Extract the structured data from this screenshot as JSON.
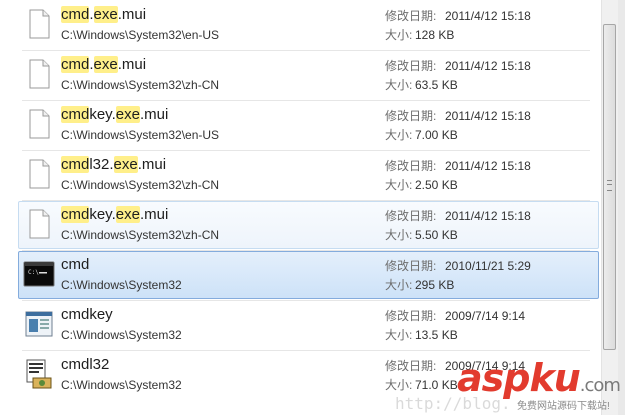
{
  "meta_labels": {
    "modified": "修改日期:",
    "size": "大小:"
  },
  "items": [
    {
      "name_parts": [
        {
          "t": "cmd",
          "hl": true
        },
        {
          "t": ".",
          "hl": false
        },
        {
          "t": "exe",
          "hl": true
        },
        {
          "t": ".mui",
          "hl": false
        }
      ],
      "path": "C:\\Windows\\System32\\en-US",
      "modified": "2011/4/12 15:18",
      "size": "128 KB",
      "icon": "blank-file-icon",
      "state": "normal"
    },
    {
      "name_parts": [
        {
          "t": "cmd",
          "hl": true
        },
        {
          "t": ".",
          "hl": false
        },
        {
          "t": "exe",
          "hl": true
        },
        {
          "t": ".mui",
          "hl": false
        }
      ],
      "path": "C:\\Windows\\System32\\zh-CN",
      "modified": "2011/4/12 15:18",
      "size": "63.5 KB",
      "icon": "blank-file-icon",
      "state": "normal"
    },
    {
      "name_parts": [
        {
          "t": "cmd",
          "hl": true
        },
        {
          "t": "key.",
          "hl": false
        },
        {
          "t": "exe",
          "hl": true
        },
        {
          "t": ".mui",
          "hl": false
        }
      ],
      "path": "C:\\Windows\\System32\\en-US",
      "modified": "2011/4/12 15:18",
      "size": "7.00 KB",
      "icon": "blank-file-icon",
      "state": "normal"
    },
    {
      "name_parts": [
        {
          "t": "cmd",
          "hl": true
        },
        {
          "t": "l32.",
          "hl": false
        },
        {
          "t": "exe",
          "hl": true
        },
        {
          "t": ".mui",
          "hl": false
        }
      ],
      "path": "C:\\Windows\\System32\\zh-CN",
      "modified": "2011/4/12 15:18",
      "size": "2.50 KB",
      "icon": "blank-file-icon",
      "state": "normal"
    },
    {
      "name_parts": [
        {
          "t": "cmd",
          "hl": true
        },
        {
          "t": "key.",
          "hl": false
        },
        {
          "t": "exe",
          "hl": true
        },
        {
          "t": ".mui",
          "hl": false
        }
      ],
      "path": "C:\\Windows\\System32\\zh-CN",
      "modified": "2011/4/12 15:18",
      "size": "5.50 KB",
      "icon": "blank-file-icon",
      "state": "hover"
    },
    {
      "name_parts": [
        {
          "t": "cmd",
          "hl": false
        }
      ],
      "path": "C:\\Windows\\System32",
      "modified": "2010/11/21 5:29",
      "size": "295 KB",
      "icon": "console-icon",
      "state": "selected"
    },
    {
      "name_parts": [
        {
          "t": "cmdkey",
          "hl": false
        }
      ],
      "path": "C:\\Windows\\System32",
      "modified": "2009/7/14 9:14",
      "size": "13.5 KB",
      "icon": "app-window-icon",
      "state": "normal"
    },
    {
      "name_parts": [
        {
          "t": "cmdl32",
          "hl": false
        }
      ],
      "path": "C:\\Windows\\System32",
      "modified": "2009/7/14 9:14",
      "size": "71.0 KB",
      "icon": "installer-icon",
      "state": "normal"
    }
  ],
  "watermark": {
    "brand": "aspku",
    "tld": ".com",
    "tagline": "免费网站源码下载站!",
    "url": "http://blog."
  },
  "colors": {
    "highlight": "#ffef8a",
    "selected_border": "#84acdd",
    "hover_border": "#c6dcf1",
    "watermark_red": "#e23b2e"
  }
}
